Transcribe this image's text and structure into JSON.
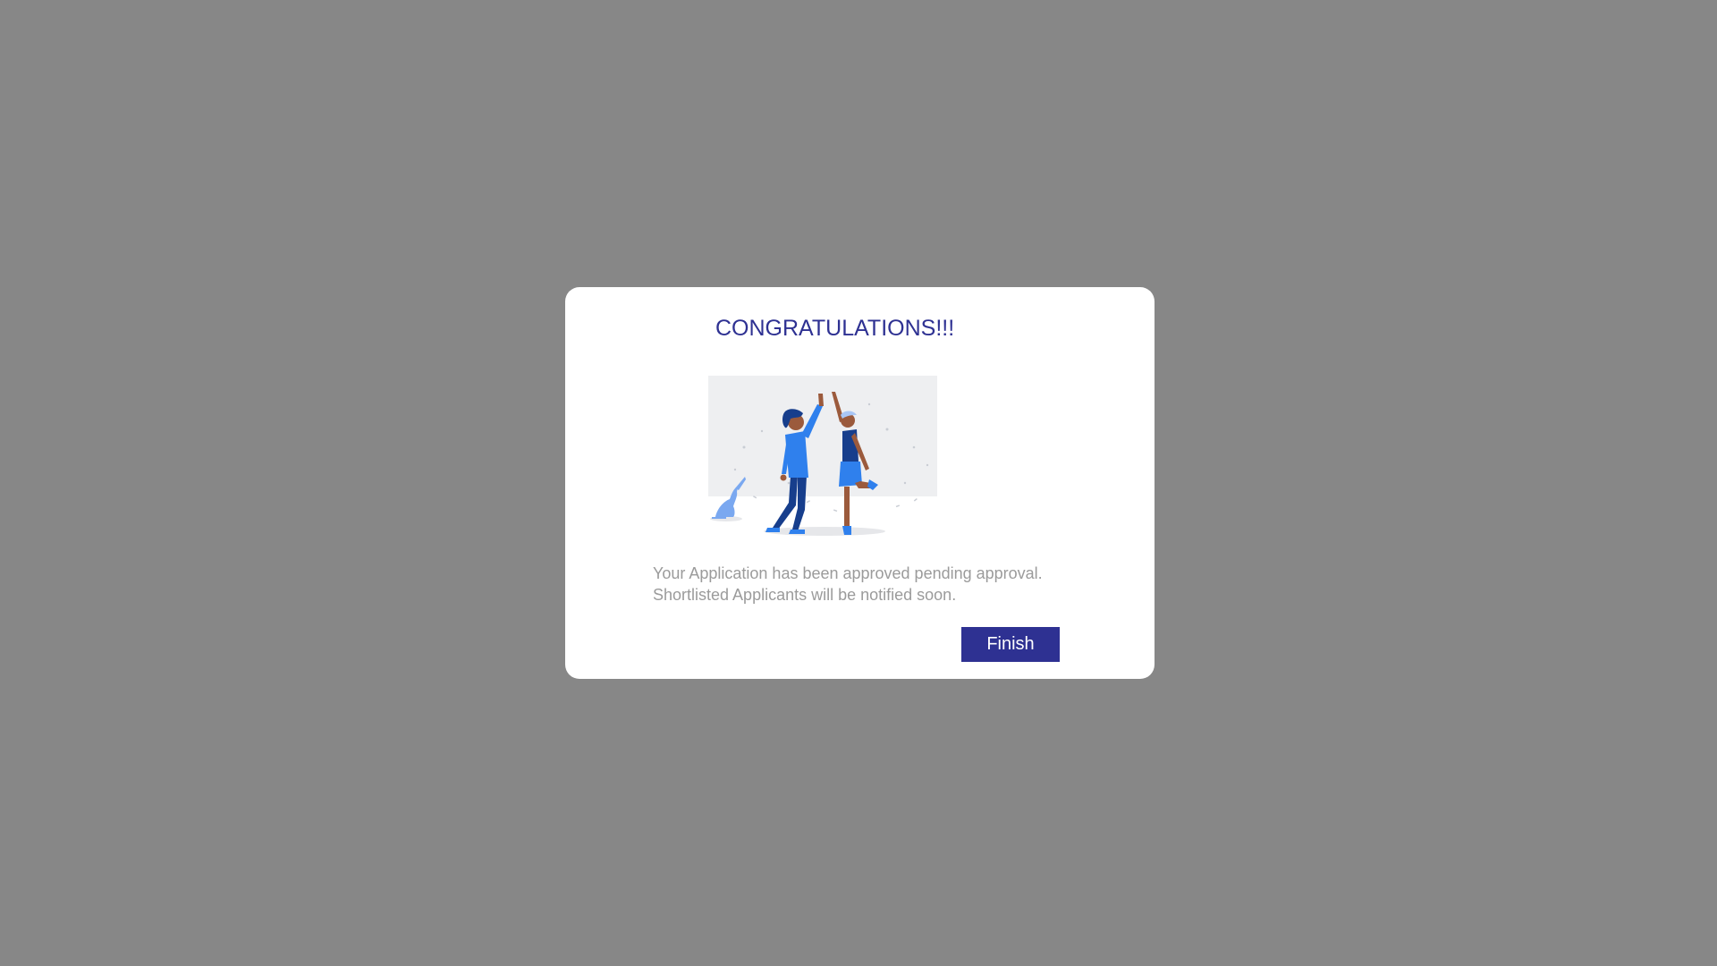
{
  "dialog": {
    "title": "CONGRATULATIONS!!!",
    "message_line1": "Your Application has been approved pending approval.",
    "message_line2": "Shortlisted Applicants will be notified soon.",
    "finish_label": "Finish",
    "illustration_icon": "high-five-celebration-illustration"
  },
  "colors": {
    "backdrop": "#878787",
    "accent": "#2e3192",
    "message_text": "#9b9b9b",
    "illustration_bg": "#eeeff1",
    "figure_blue": "#2f80ed",
    "figure_navy": "#173e8c",
    "cat_blue": "#7aa8f0",
    "skin": "#9b5a3c"
  }
}
